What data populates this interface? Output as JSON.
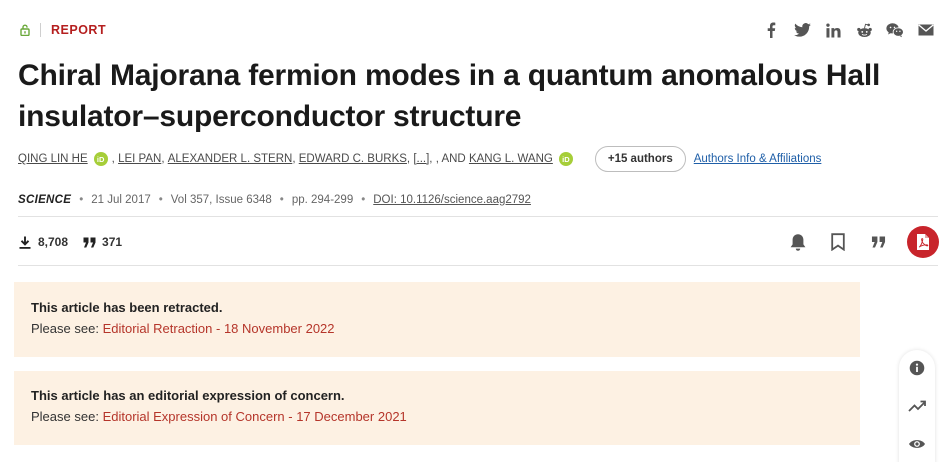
{
  "header": {
    "section_label": "REPORT",
    "share_icons": [
      "facebook-icon",
      "twitter-icon",
      "linkedin-icon",
      "reddit-icon",
      "wechat-icon",
      "email-icon"
    ]
  },
  "article": {
    "title": "Chiral Majorana fermion modes in a quantum anomalous Hall insu­lator–superconductor structure",
    "authors": {
      "first": "QING LIN HE",
      "separator_1": ",",
      "list": [
        "LEI PAN",
        "ALEXANDER L. STERN",
        "EDWARD C. BURKS",
        "[...]"
      ],
      "and_text": ", AND",
      "last": "KANG L. WANG",
      "orcid_label": "iD",
      "more_authors": "+15 authors",
      "affiliations_link": "Authors Info & Affiliations"
    },
    "meta": {
      "journal": "SCIENCE",
      "date": "21 Jul 2017",
      "volume_issue": "Vol 357, Issue 6348",
      "pages": "pp. 294-299",
      "doi": "DOI: 10.1126/science.aag2792",
      "bullet": "•"
    },
    "stats": {
      "downloads": "8,708",
      "citations": "371"
    }
  },
  "notices": [
    {
      "heading": "This article has been retracted.",
      "prefix": "Please see:",
      "link": "Editorial Retraction - 18 November 2022"
    },
    {
      "heading": "This article has an editorial expression of concern.",
      "prefix": "Please see:",
      "link": "Editorial Expression of Concern - 17 December 2021"
    }
  ],
  "colors": {
    "accent": "#b51f1f",
    "pdf_button": "#c8242b",
    "notice_bg": "#fdf1e3",
    "link_blue": "#1f5fa8",
    "orcid_green": "#a6ce39"
  }
}
